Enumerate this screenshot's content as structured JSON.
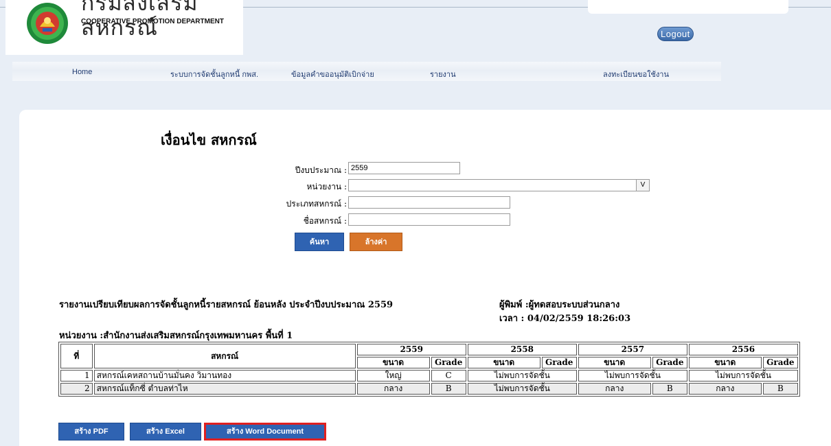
{
  "header": {
    "logo_title": "กรมส่งเสริมสหกรณ์",
    "logo_subtitle": "COOPERATIVE PROMOTION DEPARTMENT",
    "logout_label": "Logout"
  },
  "nav": {
    "items": [
      {
        "label": "Home"
      },
      {
        "label": "ระบบการจัดชั้นลูกหนี้ กพส."
      },
      {
        "label": "ข้อมูลคำขออนุมัติเบิกจ่าย"
      },
      {
        "label": "รายงาน"
      },
      {
        "label": "ลงทะเบียนขอใช้งาน"
      }
    ]
  },
  "form": {
    "title": "เงื่อนไข สหกรณ์",
    "year_label": "ปีงบประมาณ :",
    "year_value": "2559",
    "unit_label": "หน่วยงาน :",
    "unit_value": "",
    "unit_dropdown_glyph": "V",
    "type_label": "ประเภทสหกรณ์ :",
    "type_value": "",
    "name_label": "ชื่อสหกรณ์ :",
    "name_value": "",
    "search_label": "ค้นหา",
    "clear_label": "ล้างค่า"
  },
  "report": {
    "title": "รายงานเปรียบเทียบผลการจัดชั้นลูกหนี้รายสหกรณ์ ย้อนหลัง ประจำปีงบประมาณ 2559",
    "printer": "ผู้พิมพ์ :ผู้ทดสอบระบบส่วนกลาง",
    "time": "เวลา : 04/02/2559 18:26:03",
    "unit": "หน่วยงาน :สำนักงานส่งเสริมสหกรณ์กรุงเทพมหานคร พื้นที่ 1"
  },
  "table": {
    "col_no": "ที่",
    "col_coop": "สหกรณ์",
    "years": [
      "2559",
      "2558",
      "2557",
      "2556"
    ],
    "sub_size": "ขนาด",
    "sub_grade": "Grade",
    "rows": [
      {
        "no": "1",
        "name": "สหกรณ์เคหสถานบ้านมั่นคง วิมานทอง",
        "y2559_size": "ใหญ่",
        "y2559_grade": "C",
        "y2558_merged": "ไม่พบการจัดชั้น",
        "y2557_merged": "ไม่พบการจัดชั้น",
        "y2556_merged": "ไม่พบการจัดชั้น"
      },
      {
        "no": "2",
        "name": "สหกรณ์แท็กซี่ ตำบลท่าไห",
        "y2559_size": "กลาง",
        "y2559_grade": "B",
        "y2558_merged": "ไม่พบการจัดชั้น",
        "y2557_size": "กลาง",
        "y2557_grade": "B",
        "y2556_size": "กลาง",
        "y2556_grade": "B"
      }
    ]
  },
  "export": {
    "pdf_label": "สร้าง PDF",
    "excel_label": "สร้าง Excel",
    "word_label": "สร้าง Word Document"
  }
}
